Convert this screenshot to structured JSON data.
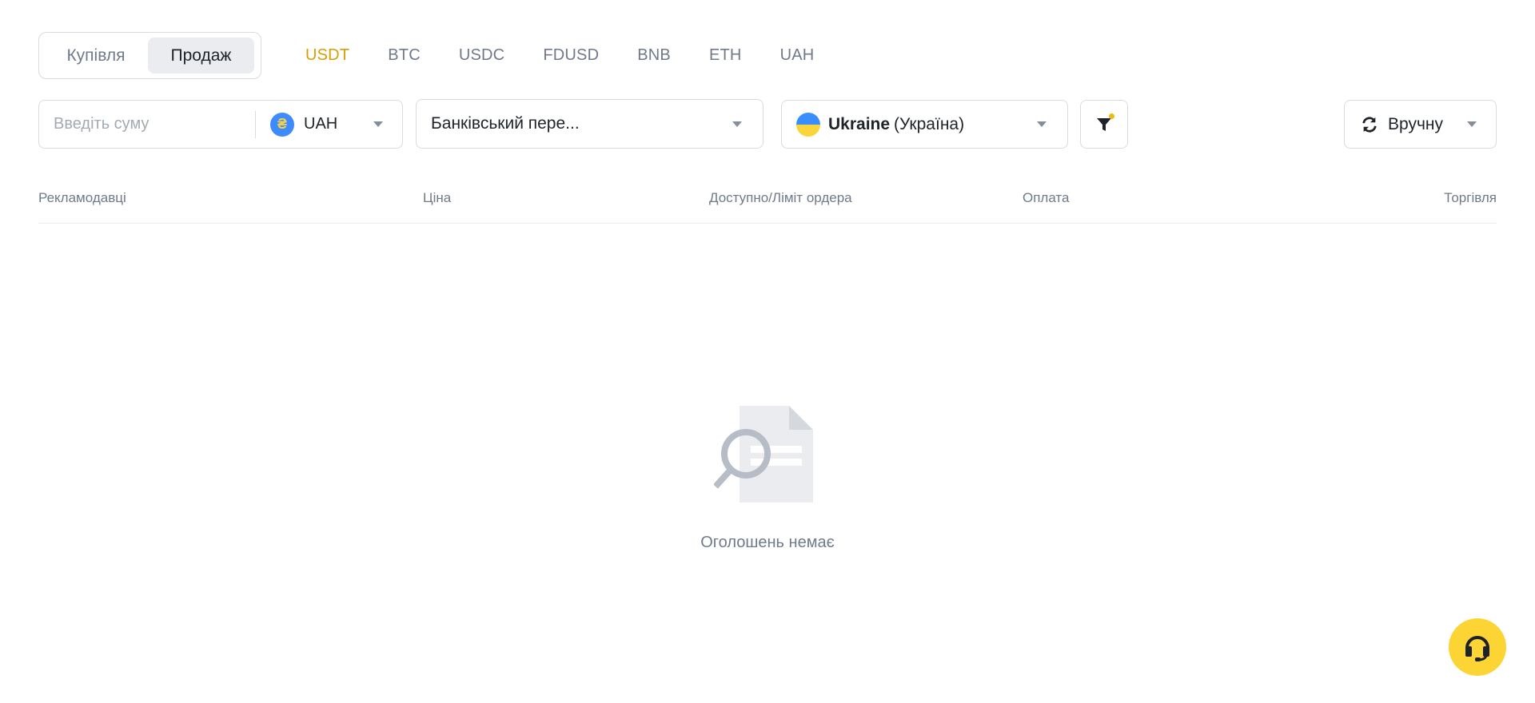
{
  "trade_toggle": {
    "buy_label": "Купівля",
    "sell_label": "Продаж",
    "selected": "sell"
  },
  "asset_tabs": [
    {
      "label": "USDT",
      "active": true
    },
    {
      "label": "BTC",
      "active": false
    },
    {
      "label": "USDC",
      "active": false
    },
    {
      "label": "FDUSD",
      "active": false
    },
    {
      "label": "BNB",
      "active": false
    },
    {
      "label": "ETH",
      "active": false
    },
    {
      "label": "UAH",
      "active": false
    }
  ],
  "amount": {
    "placeholder": "Введіть суму",
    "value": "",
    "currency": "UAH",
    "currency_symbol": "₴"
  },
  "payment_method": {
    "selected": "Банківський пере..."
  },
  "country": {
    "name": "Ukraine",
    "native": "(Україна)"
  },
  "refresh": {
    "label": "Вручну"
  },
  "table": {
    "headers": {
      "advertisers": "Рекламодавці",
      "price": "Ціна",
      "available": "Доступно/Ліміт ордера",
      "payment": "Оплата",
      "trade": "Торгівля"
    },
    "rows": []
  },
  "empty_state": {
    "message": "Оголошень немає"
  },
  "colors": {
    "accent": "#d89f00",
    "fab": "#fcd535",
    "filter_dot": "#f0b90b",
    "muted_text": "#707a8a",
    "border": "#d8dce1"
  },
  "icons": {
    "support": "headset-icon",
    "filter": "funnel-icon",
    "refresh": "refresh-icon",
    "empty": "document-search-icon"
  }
}
